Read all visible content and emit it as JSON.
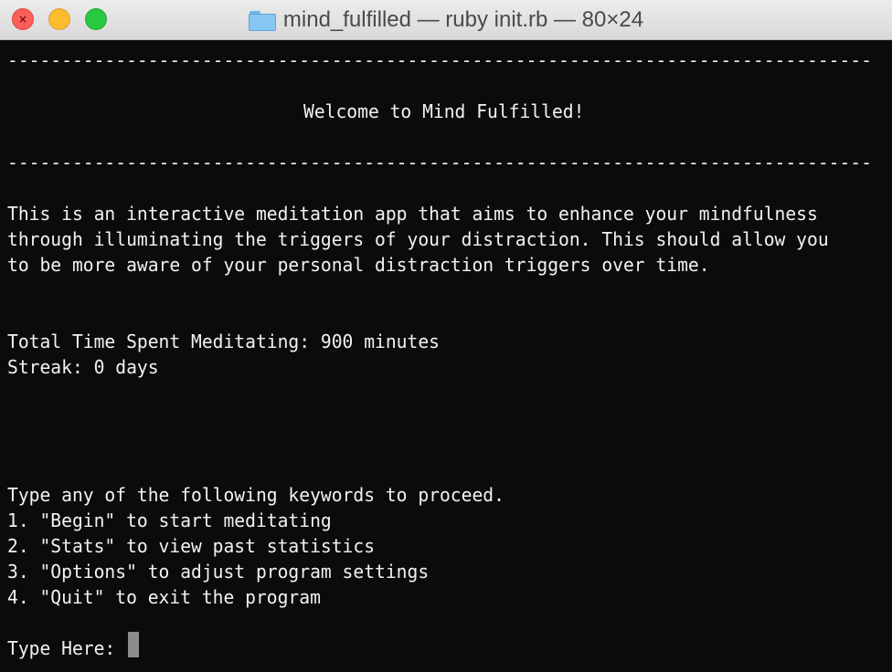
{
  "window": {
    "title": "mind_fulfilled — ruby init.rb — 80×24",
    "icon": "folder-icon"
  },
  "terminal": {
    "divider_top": "--------------------------------------------------------------------------------",
    "welcome": "Welcome to Mind Fulfilled!",
    "divider_bottom": "--------------------------------------------------------------------------------",
    "description": [
      "This is an interactive meditation app that aims to enhance your mindfulness",
      "through illuminating the triggers of your distraction. This should allow you",
      "to be more aware of your personal distraction triggers over time."
    ],
    "stats": {
      "total_time": "Total Time Spent Meditating: 900 minutes",
      "streak": "Streak: 0 days"
    },
    "instructions": "Type any of the following keywords to proceed.",
    "options": [
      "1. \"Begin\" to start meditating",
      "2. \"Stats\" to view past statistics",
      "3. \"Options\" to adjust program settings",
      "4. \"Quit\" to exit the program"
    ],
    "prompt": "Type Here: ",
    "input_value": ""
  },
  "colors": {
    "background": "#0b0b0b",
    "text": "#f2f2f2",
    "cursor": "#8c8c8c",
    "close": "#fc5f57",
    "minimize": "#fdbc2e",
    "maximize": "#28c840"
  }
}
